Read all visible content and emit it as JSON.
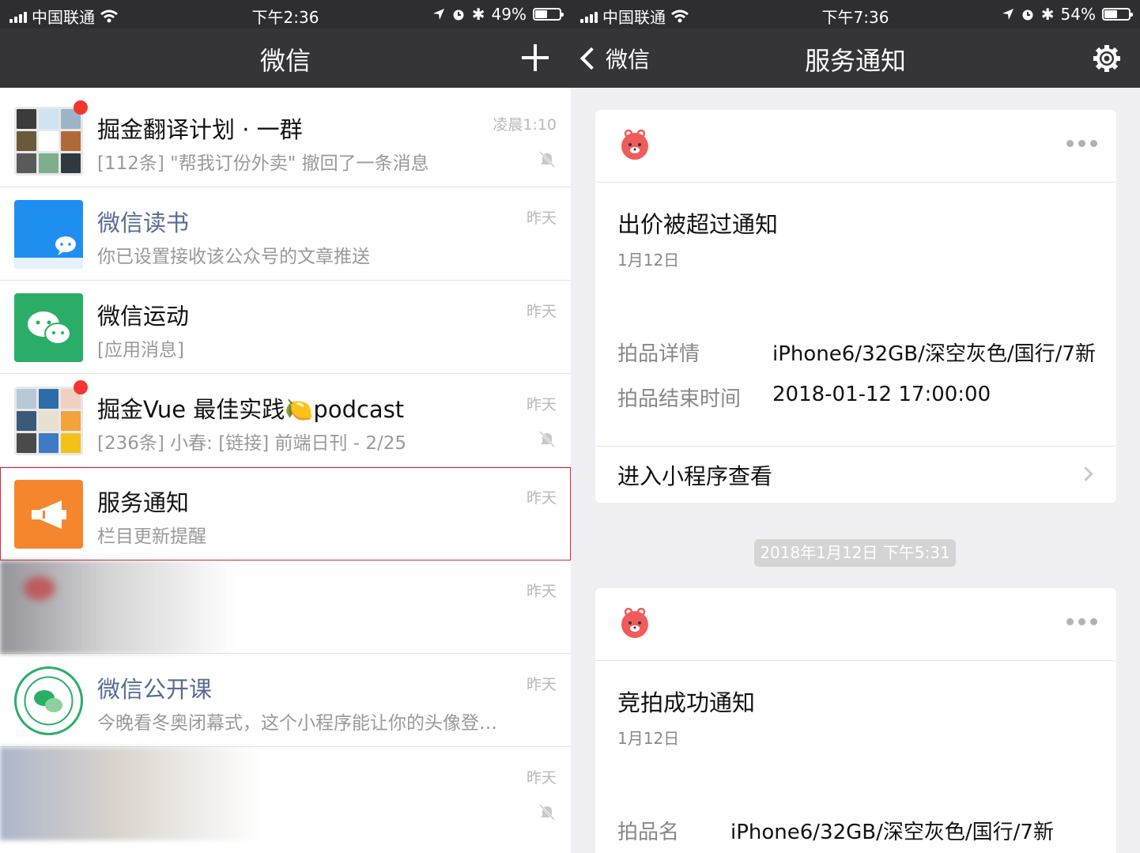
{
  "left": {
    "status": {
      "carrier": "中国联通",
      "time": "下午2:36",
      "battery": "49%",
      "battery_level": 0.49
    },
    "nav": {
      "title": "微信"
    },
    "chats": [
      {
        "name": "掘金翻译计划 · 一群",
        "message": "[112条] \"帮我订份外卖\" 撤回了一条消息",
        "time": "凌晨1:10",
        "muted": true,
        "unread": true
      },
      {
        "name": "微信读书",
        "message": "你已设置接收该公众号的文章推送",
        "time": "昨天"
      },
      {
        "name": "微信运动",
        "message": "[应用消息]",
        "time": "昨天"
      },
      {
        "name": "掘金Vue 最佳实践🍋podcast",
        "message": "[236条] 小春: [链接] 前端日刊 - 2/25",
        "time": "昨天",
        "muted": true,
        "unread": true
      },
      {
        "name": "服务通知",
        "message": "栏目更新提醒",
        "time": "昨天"
      },
      {
        "name": "",
        "message": "",
        "time": "昨天"
      },
      {
        "name": "微信公开课",
        "message": "今晚看冬奥闭幕式，这个小程序能让你的头像登…",
        "time": "昨天"
      },
      {
        "name": "",
        "message": "",
        "time": "昨天",
        "muted": true
      }
    ]
  },
  "right": {
    "status": {
      "carrier": "中国联通",
      "time": "下午7:36",
      "battery": "54%",
      "battery_level": 0.54
    },
    "nav": {
      "back": "微信",
      "title": "服务通知"
    },
    "card1": {
      "title": "出价被超过通知",
      "date": "1月12日",
      "rows": [
        {
          "label": "拍品详情",
          "value": "iPhone6/32GB/深空灰色/国行/7新"
        },
        {
          "label": "拍品结束时间",
          "value": "2018-01-12 17:00:00"
        }
      ],
      "link": "进入小程序查看"
    },
    "timestamp": "2018年1月12日 下午5:31",
    "card2": {
      "title": "竞拍成功通知",
      "date": "1月12日",
      "rows": [
        {
          "label": "拍品名",
          "value": "iPhone6/32GB/深空灰色/国行/7新"
        }
      ]
    }
  }
}
